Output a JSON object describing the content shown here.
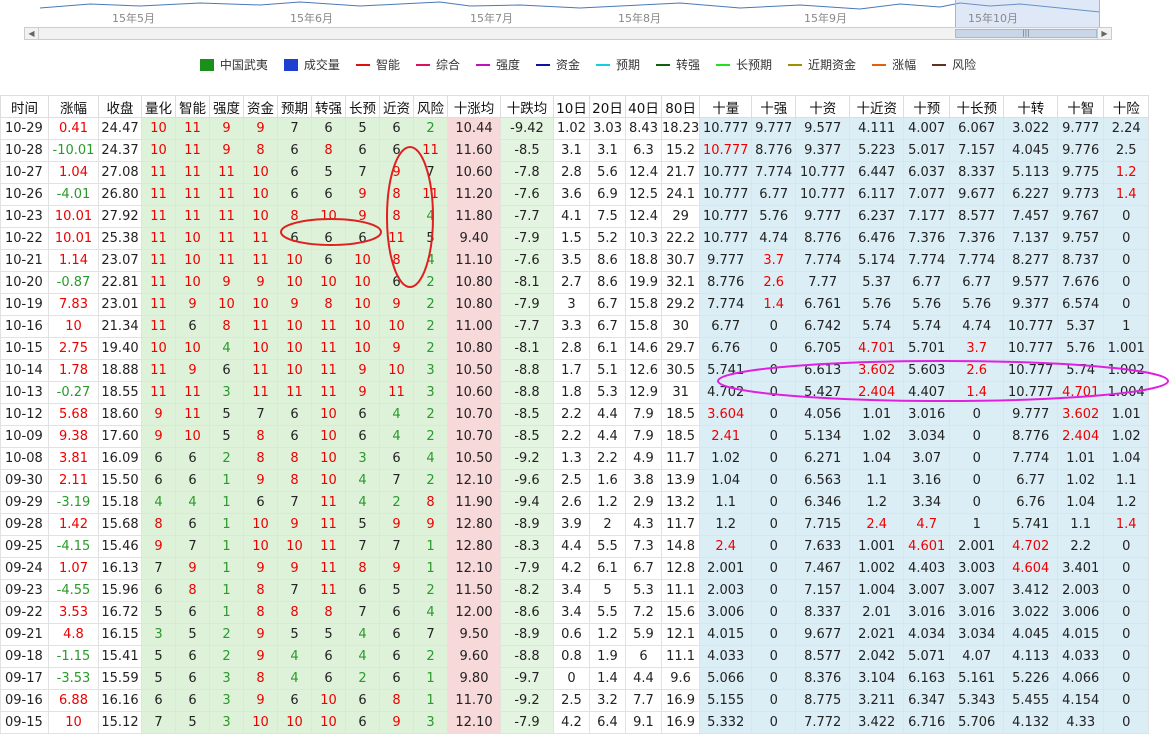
{
  "navigator": {
    "months": [
      "15年5月",
      "15年6月",
      "15年7月",
      "15年8月",
      "15年9月",
      "15年10月"
    ]
  },
  "legend": [
    {
      "label": "中国武夷",
      "color": "#1a8f1a",
      "shape": "box"
    },
    {
      "label": "成交量",
      "color": "#1f3fd1",
      "shape": "box"
    },
    {
      "label": "智能",
      "color": "#e01010",
      "shape": "line"
    },
    {
      "label": "综合",
      "color": "#e01060",
      "shape": "line"
    },
    {
      "label": "强度",
      "color": "#c010c0",
      "shape": "line"
    },
    {
      "label": "资金",
      "color": "#1010a0",
      "shape": "line"
    },
    {
      "label": "预期",
      "color": "#10d0e0",
      "shape": "line"
    },
    {
      "label": "转强",
      "color": "#106010",
      "shape": "line"
    },
    {
      "label": "长预期",
      "color": "#20e020",
      "shape": "line"
    },
    {
      "label": "近期资金",
      "color": "#a09000",
      "shape": "line"
    },
    {
      "label": "涨幅",
      "color": "#e06010",
      "shape": "line"
    },
    {
      "label": "风险",
      "color": "#603020",
      "shape": "line"
    }
  ],
  "headers": [
    "时间",
    "涨幅",
    "收盘",
    "量化",
    "智能",
    "强度",
    "资金",
    "预期",
    "转强",
    "长预",
    "近资",
    "风险",
    "十涨均",
    "十跌均",
    "10日",
    "20日",
    "40日",
    "80日",
    "十量",
    "十强",
    "十资",
    "十近资",
    "十预",
    "十长预",
    "十转",
    "十智",
    "十险"
  ],
  "rows": [
    [
      "10-29",
      "0.41",
      "24.47",
      "10",
      "11",
      "9",
      "9",
      "7",
      "6",
      "5",
      "6",
      "2",
      "10.44",
      "-9.42",
      "1.02",
      "3.03",
      "8.43",
      "18.23",
      "10.777",
      "9.777",
      "9.577",
      "4.111",
      "4.007",
      "6.067",
      "3.022",
      "9.777",
      "2.24"
    ],
    [
      "10-28",
      "-10.01",
      "24.37",
      "10",
      "11",
      "9",
      "8",
      "6",
      "8",
      "6",
      "6",
      "11",
      "11.60",
      "-8.5",
      "3.1",
      "3.1",
      "6.3",
      "15.2",
      "10.777",
      "8.776",
      "9.377",
      "5.223",
      "5.017",
      "7.157",
      "4.045",
      "9.776",
      "2.5"
    ],
    [
      "10-27",
      "1.04",
      "27.08",
      "11",
      "11",
      "11",
      "10",
      "6",
      "5",
      "7",
      "9",
      "7",
      "10.60",
      "-7.8",
      "2.8",
      "5.6",
      "12.4",
      "21.7",
      "10.777",
      "7.774",
      "10.777",
      "6.447",
      "6.037",
      "8.337",
      "5.113",
      "9.775",
      "1.2"
    ],
    [
      "10-26",
      "-4.01",
      "26.80",
      "11",
      "11",
      "11",
      "10",
      "6",
      "6",
      "9",
      "8",
      "11",
      "11.20",
      "-7.6",
      "3.6",
      "6.9",
      "12.5",
      "24.1",
      "10.777",
      "6.77",
      "10.777",
      "6.117",
      "7.077",
      "9.677",
      "6.227",
      "9.773",
      "1.4"
    ],
    [
      "10-23",
      "10.01",
      "27.92",
      "11",
      "11",
      "11",
      "10",
      "8",
      "10",
      "9",
      "8",
      "4",
      "11.80",
      "-7.7",
      "4.1",
      "7.5",
      "12.4",
      "29",
      "10.777",
      "5.76",
      "9.777",
      "6.237",
      "7.177",
      "8.577",
      "7.457",
      "9.767",
      "0"
    ],
    [
      "10-22",
      "10.01",
      "25.38",
      "11",
      "10",
      "11",
      "11",
      "6",
      "6",
      "6",
      "11",
      "5",
      "9.40",
      "-7.9",
      "1.5",
      "5.2",
      "10.3",
      "22.2",
      "10.777",
      "4.74",
      "8.776",
      "6.476",
      "7.376",
      "7.376",
      "7.137",
      "9.757",
      "0"
    ],
    [
      "10-21",
      "1.14",
      "23.07",
      "11",
      "10",
      "11",
      "11",
      "10",
      "6",
      "10",
      "8",
      "4",
      "11.10",
      "-7.6",
      "3.5",
      "8.6",
      "18.8",
      "30.7",
      "9.777",
      "3.7",
      "7.774",
      "5.174",
      "7.774",
      "7.774",
      "8.277",
      "8.737",
      "0"
    ],
    [
      "10-20",
      "-0.87",
      "22.81",
      "11",
      "10",
      "9",
      "9",
      "10",
      "10",
      "10",
      "6",
      "2",
      "10.80",
      "-8.1",
      "2.7",
      "8.6",
      "19.9",
      "32.1",
      "8.776",
      "2.6",
      "7.77",
      "5.37",
      "6.77",
      "6.77",
      "9.577",
      "7.676",
      "0"
    ],
    [
      "10-19",
      "7.83",
      "23.01",
      "11",
      "9",
      "10",
      "10",
      "9",
      "8",
      "10",
      "9",
      "2",
      "10.80",
      "-7.9",
      "3",
      "6.7",
      "15.8",
      "29.2",
      "7.774",
      "1.4",
      "6.761",
      "5.76",
      "5.76",
      "5.76",
      "9.377",
      "6.574",
      "0"
    ],
    [
      "10-16",
      "10",
      "21.34",
      "11",
      "6",
      "8",
      "11",
      "10",
      "11",
      "10",
      "10",
      "2",
      "11.00",
      "-7.7",
      "3.3",
      "6.7",
      "15.8",
      "30",
      "6.77",
      "0",
      "6.742",
      "5.74",
      "5.74",
      "4.74",
      "10.777",
      "5.37",
      "1"
    ],
    [
      "10-15",
      "2.75",
      "19.40",
      "10",
      "10",
      "4",
      "10",
      "10",
      "11",
      "10",
      "9",
      "2",
      "10.80",
      "-8.1",
      "2.8",
      "6.1",
      "14.6",
      "29.7",
      "6.76",
      "0",
      "6.705",
      "4.701",
      "5.701",
      "3.7",
      "10.777",
      "5.76",
      "1.001"
    ],
    [
      "10-14",
      "1.78",
      "18.88",
      "11",
      "9",
      "6",
      "11",
      "10",
      "11",
      "9",
      "10",
      "3",
      "10.50",
      "-8.8",
      "1.7",
      "5.1",
      "12.6",
      "30.5",
      "5.741",
      "0",
      "6.613",
      "3.602",
      "5.603",
      "2.6",
      "10.777",
      "5.74",
      "1.002"
    ],
    [
      "10-13",
      "-0.27",
      "18.55",
      "11",
      "11",
      "3",
      "11",
      "11",
      "11",
      "9",
      "11",
      "3",
      "10.60",
      "-8.8",
      "1.8",
      "5.3",
      "12.9",
      "31",
      "4.702",
      "0",
      "5.427",
      "2.404",
      "4.407",
      "1.4",
      "10.777",
      "4.701",
      "1.004"
    ],
    [
      "10-12",
      "5.68",
      "18.60",
      "9",
      "11",
      "5",
      "7",
      "6",
      "10",
      "6",
      "4",
      "2",
      "10.70",
      "-8.5",
      "2.2",
      "4.4",
      "7.9",
      "18.5",
      "3.604",
      "0",
      "4.056",
      "1.01",
      "3.016",
      "0",
      "9.777",
      "3.602",
      "1.01"
    ],
    [
      "10-09",
      "9.38",
      "17.60",
      "9",
      "10",
      "5",
      "8",
      "6",
      "10",
      "6",
      "4",
      "2",
      "10.70",
      "-8.5",
      "2.2",
      "4.4",
      "7.9",
      "18.5",
      "2.41",
      "0",
      "5.134",
      "1.02",
      "3.034",
      "0",
      "8.776",
      "2.404",
      "1.02"
    ],
    [
      "10-08",
      "3.81",
      "16.09",
      "6",
      "6",
      "2",
      "8",
      "8",
      "10",
      "3",
      "6",
      "4",
      "10.50",
      "-9.2",
      "1.3",
      "2.2",
      "4.9",
      "11.7",
      "1.02",
      "0",
      "6.271",
      "1.04",
      "3.07",
      "0",
      "7.774",
      "1.01",
      "1.04"
    ],
    [
      "09-30",
      "2.11",
      "15.50",
      "6",
      "6",
      "1",
      "9",
      "8",
      "10",
      "4",
      "7",
      "2",
      "12.10",
      "-9.6",
      "2.5",
      "1.6",
      "3.8",
      "13.9",
      "1.04",
      "0",
      "6.563",
      "1.1",
      "3.16",
      "0",
      "6.77",
      "1.02",
      "1.1"
    ],
    [
      "09-29",
      "-3.19",
      "15.18",
      "4",
      "4",
      "1",
      "6",
      "7",
      "11",
      "4",
      "2",
      "8",
      "11.90",
      "-9.4",
      "2.6",
      "1.2",
      "2.9",
      "13.2",
      "1.1",
      "0",
      "6.346",
      "1.2",
      "3.34",
      "0",
      "6.76",
      "1.04",
      "1.2"
    ],
    [
      "09-28",
      "1.42",
      "15.68",
      "8",
      "6",
      "1",
      "10",
      "9",
      "11",
      "5",
      "9",
      "9",
      "12.80",
      "-8.9",
      "3.9",
      "2",
      "4.3",
      "11.7",
      "1.2",
      "0",
      "7.715",
      "2.4",
      "4.7",
      "1",
      "5.741",
      "1.1",
      "1.4"
    ],
    [
      "09-25",
      "-4.15",
      "15.46",
      "9",
      "7",
      "1",
      "10",
      "10",
      "11",
      "7",
      "7",
      "1",
      "12.80",
      "-8.3",
      "4.4",
      "5.5",
      "7.3",
      "14.8",
      "2.4",
      "0",
      "7.633",
      "1.001",
      "4.601",
      "2.001",
      "4.702",
      "2.2",
      "0"
    ],
    [
      "09-24",
      "1.07",
      "16.13",
      "7",
      "9",
      "1",
      "9",
      "9",
      "11",
      "8",
      "9",
      "1",
      "12.10",
      "-7.9",
      "4.2",
      "6.1",
      "6.7",
      "12.8",
      "2.001",
      "0",
      "7.467",
      "1.002",
      "4.403",
      "3.003",
      "4.604",
      "3.401",
      "0"
    ],
    [
      "09-23",
      "-4.55",
      "15.96",
      "6",
      "8",
      "1",
      "8",
      "7",
      "11",
      "6",
      "5",
      "2",
      "11.50",
      "-8.2",
      "3.4",
      "5",
      "5.3",
      "11.1",
      "2.003",
      "0",
      "7.157",
      "1.004",
      "3.007",
      "3.007",
      "3.412",
      "2.003",
      "0"
    ],
    [
      "09-22",
      "3.53",
      "16.72",
      "5",
      "6",
      "1",
      "8",
      "8",
      "8",
      "7",
      "6",
      "4",
      "12.00",
      "-8.6",
      "3.4",
      "5.5",
      "7.2",
      "15.6",
      "3.006",
      "0",
      "8.337",
      "2.01",
      "3.016",
      "3.016",
      "3.022",
      "3.006",
      "0"
    ],
    [
      "09-21",
      "4.8",
      "16.15",
      "3",
      "5",
      "2",
      "9",
      "5",
      "5",
      "4",
      "6",
      "7",
      "9.50",
      "-8.9",
      "0.6",
      "1.2",
      "5.9",
      "12.1",
      "4.015",
      "0",
      "9.677",
      "2.021",
      "4.034",
      "3.034",
      "4.045",
      "4.015",
      "0"
    ],
    [
      "09-18",
      "-1.15",
      "15.41",
      "5",
      "6",
      "2",
      "9",
      "4",
      "6",
      "4",
      "6",
      "2",
      "9.60",
      "-8.8",
      "0.8",
      "1.9",
      "6",
      "11.1",
      "4.033",
      "0",
      "8.577",
      "2.042",
      "5.071",
      "4.07",
      "4.113",
      "4.033",
      "0"
    ],
    [
      "09-17",
      "-3.53",
      "15.59",
      "5",
      "6",
      "3",
      "8",
      "4",
      "6",
      "2",
      "6",
      "1",
      "9.80",
      "-9.7",
      "0",
      "1.4",
      "4.4",
      "9.6",
      "5.066",
      "0",
      "8.376",
      "3.104",
      "6.163",
      "5.161",
      "5.226",
      "4.066",
      "0"
    ],
    [
      "09-16",
      "6.88",
      "16.16",
      "6",
      "6",
      "3",
      "9",
      "6",
      "10",
      "6",
      "8",
      "1",
      "11.70",
      "-9.2",
      "2.5",
      "3.2",
      "7.7",
      "16.9",
      "5.155",
      "0",
      "8.775",
      "3.211",
      "6.347",
      "5.343",
      "5.455",
      "4.154",
      "0"
    ],
    [
      "09-15",
      "10",
      "15.12",
      "7",
      "5",
      "3",
      "10",
      "10",
      "10",
      "6",
      "9",
      "3",
      "12.10",
      "-7.9",
      "4.2",
      "6.4",
      "9.1",
      "16.9",
      "5.332",
      "0",
      "7.772",
      "3.422",
      "6.716",
      "5.706",
      "4.132",
      "4.33",
      "0"
    ]
  ],
  "red_cells": [
    [
      1,
      "18"
    ],
    [
      2,
      "26"
    ],
    [
      3,
      "26"
    ],
    [
      6,
      "19"
    ],
    [
      7,
      "19"
    ],
    [
      8,
      "19"
    ],
    [
      10,
      "21"
    ],
    [
      10,
      "23"
    ],
    [
      11,
      "21"
    ],
    [
      11,
      "23"
    ],
    [
      12,
      "21"
    ],
    [
      12,
      "23"
    ],
    [
      12,
      "25"
    ],
    [
      13,
      "18"
    ],
    [
      13,
      "25"
    ],
    [
      14,
      "18"
    ],
    [
      14,
      "25"
    ],
    [
      18,
      "21"
    ],
    [
      18,
      "22"
    ],
    [
      18,
      "26"
    ],
    [
      19,
      "18"
    ],
    [
      19,
      "22"
    ],
    [
      19,
      "24"
    ],
    [
      20,
      "24"
    ]
  ]
}
